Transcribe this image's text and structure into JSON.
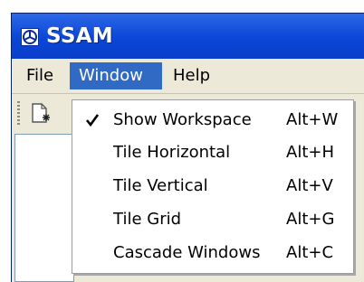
{
  "app": {
    "title": "SSAM"
  },
  "menubar": {
    "items": [
      {
        "label": "File"
      },
      {
        "label": "Window"
      },
      {
        "label": "Help"
      }
    ]
  },
  "window_menu": {
    "items": [
      {
        "label": "Show Workspace",
        "shortcut": "Alt+W",
        "checked": true
      },
      {
        "label": "Tile Horizontal",
        "shortcut": "Alt+H"
      },
      {
        "label": "Tile Vertical",
        "shortcut": "Alt+V"
      },
      {
        "label": "Tile Grid",
        "shortcut": "Alt+G"
      },
      {
        "label": "Cascade Windows",
        "shortcut": "Alt+C"
      }
    ]
  },
  "icons": {
    "app": "app-logo-icon",
    "check": "checkmark-icon",
    "toolbar": "new-document-icon"
  },
  "colors": {
    "title_bar": "#0a46d8",
    "menu_highlight": "#316ac5",
    "menu_bg": "#ece9d8"
  }
}
